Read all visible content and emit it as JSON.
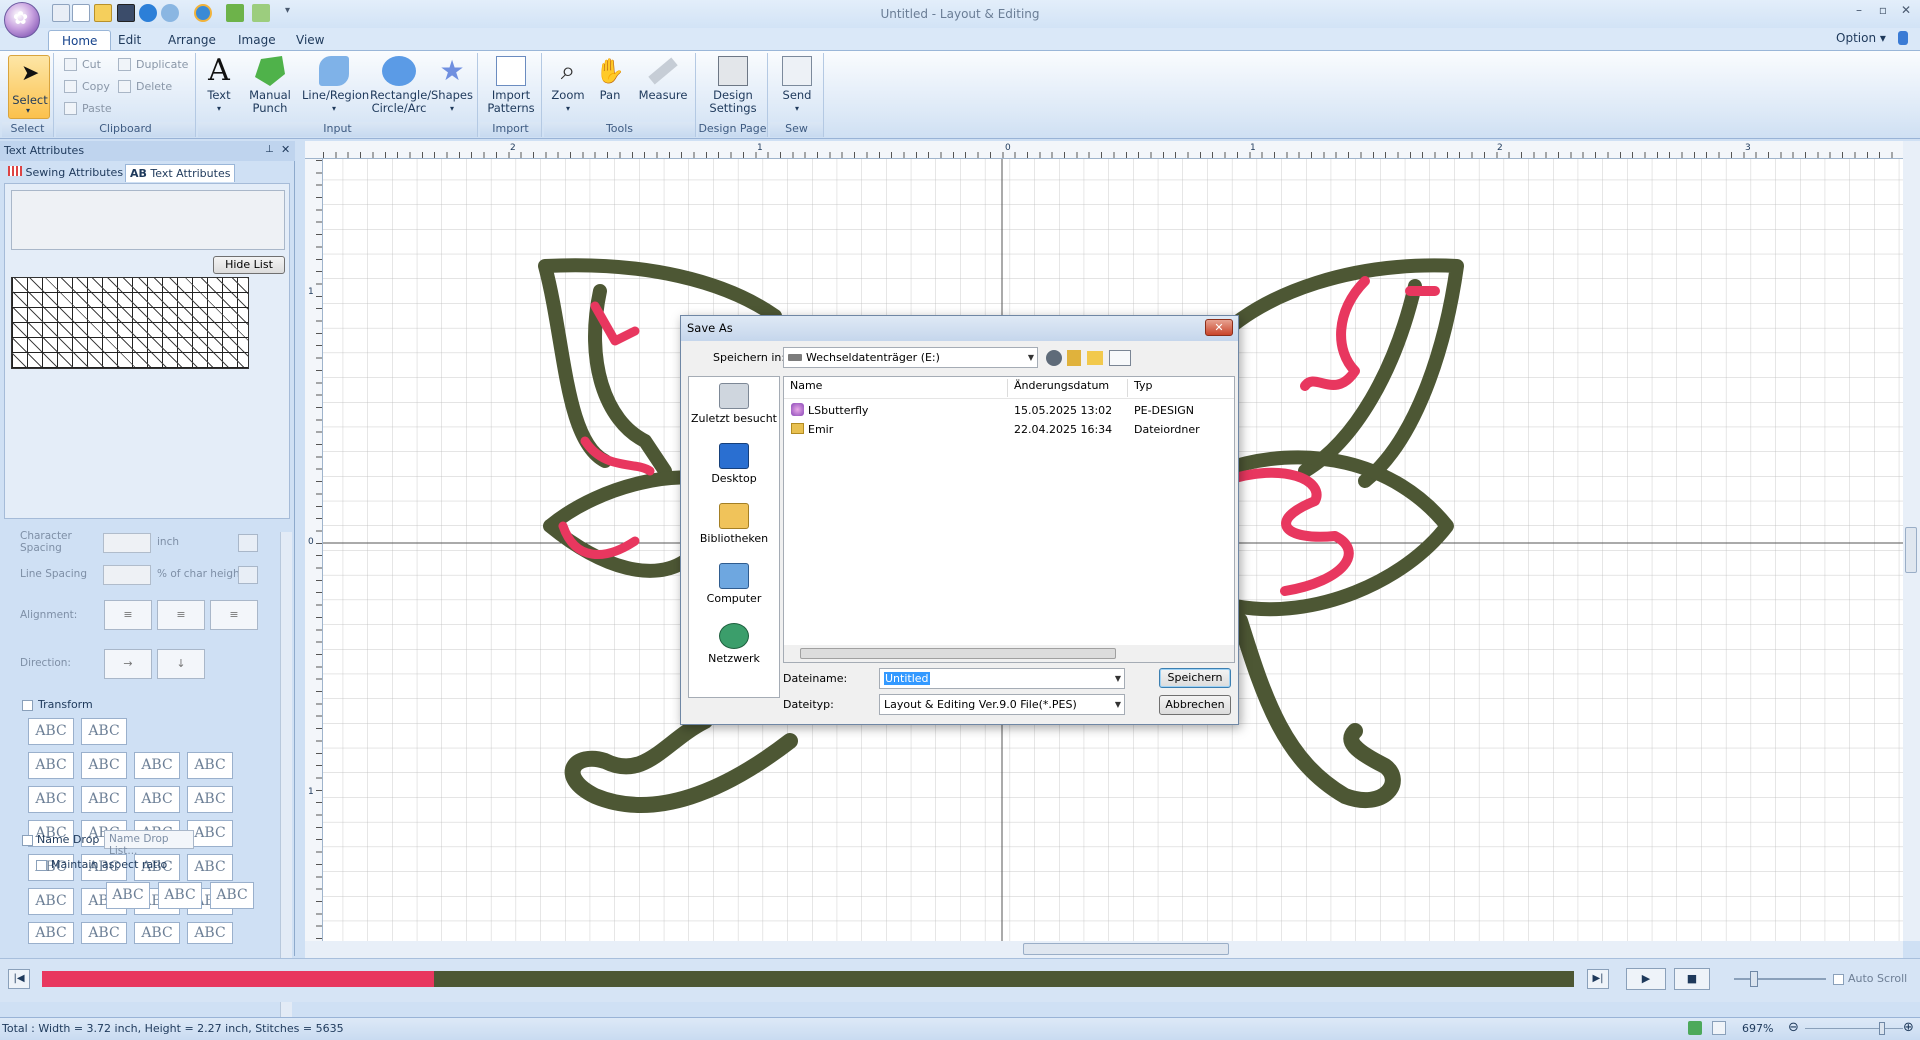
{
  "window": {
    "title": "Untitled - Layout & Editing",
    "option_label": "Option"
  },
  "tabs": [
    "Home",
    "Edit",
    "Arrange",
    "Image",
    "View"
  ],
  "ribbon": {
    "select": {
      "label": "Select",
      "group": "Select"
    },
    "clipboard": {
      "cut": "Cut",
      "copy": "Copy",
      "paste": "Paste",
      "duplicate": "Duplicate",
      "delete": "Delete",
      "group": "Clipboard"
    },
    "input": {
      "text": "Text",
      "manual_punch_1": "Manual",
      "manual_punch_2": "Punch",
      "line_region": "Line/Region",
      "rect_1": "Rectangle/",
      "rect_2": "Circle/Arc",
      "shapes": "Shapes",
      "group": "Input"
    },
    "import": {
      "l1": "Import",
      "l2": "Patterns",
      "group": "Import"
    },
    "tools": {
      "zoom": "Zoom",
      "pan": "Pan",
      "measure": "Measure",
      "group": "Tools"
    },
    "design_page": {
      "l1": "Design",
      "l2": "Settings",
      "group": "Design Page"
    },
    "sew": {
      "send": "Send",
      "group": "Sew"
    }
  },
  "panel": {
    "title": "Text Attributes",
    "tab_sewing": "Sewing Attributes",
    "tab_text": "Text Attributes",
    "hide_list": "Hide List",
    "char_spacing_1": "Character",
    "char_spacing_2": "Spacing",
    "char_unit": "inch",
    "line_spacing": "Line Spacing",
    "line_unit": "% of char height",
    "alignment": "Alignment:",
    "direction": "Direction:",
    "transform": "Transform",
    "name_drop": "Name Drop",
    "name_drop_list": "Name Drop List...",
    "maintain_aspect": "Maintain aspect ratio",
    "abc": "ABC"
  },
  "dialog": {
    "title": "Save As",
    "save_in_label": "Speichern in:",
    "save_in_value": "Wechseldatenträger (E:)",
    "places": [
      "Zuletzt besucht",
      "Desktop",
      "Bibliotheken",
      "Computer",
      "Netzwerk"
    ],
    "columns": [
      "Name",
      "Änderungsdatum",
      "Typ"
    ],
    "files": [
      {
        "name": "LSbutterfly",
        "date": "15.05.2025 13:02",
        "type": "PE-DESIGN"
      },
      {
        "name": "Emir",
        "date": "22.04.2025 16:34",
        "type": "Dateiordner"
      }
    ],
    "filename_label": "Dateiname:",
    "filename_value": "Untitled",
    "filetype_label": "Dateityp:",
    "filetype_value": "Layout & Editing Ver.9.0 File(*.PES)",
    "save_button": "Speichern",
    "cancel_button": "Abbrechen"
  },
  "rulers": {
    "top": [
      "2",
      "1",
      "0",
      "1",
      "2",
      "3"
    ],
    "left": [
      "1",
      "0",
      "1"
    ]
  },
  "playback": {
    "auto_scroll": "Auto Scroll",
    "progress": 0.256
  },
  "status": {
    "text": "Total : Width = 3.72 inch, Height = 2.27 inch, Stitches = 5635",
    "zoom": "697%"
  },
  "colors": {
    "thread_pink": "#e8375f",
    "thread_olive": "#4d5734",
    "accent": "#15428b"
  }
}
